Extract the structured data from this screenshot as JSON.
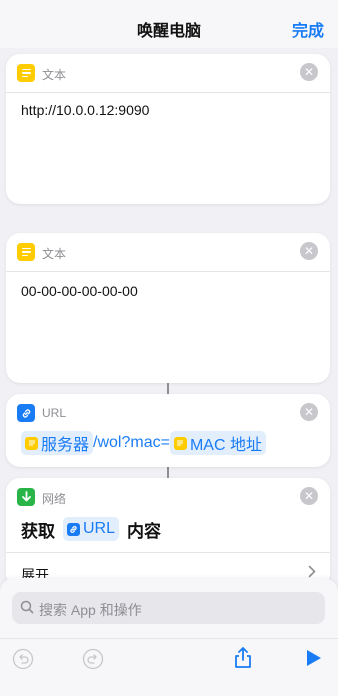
{
  "nav": {
    "title": "唤醒电脑",
    "done_label": "完成"
  },
  "actions": [
    {
      "label": "文本",
      "value": "http://10.0.0.12:9090",
      "icon": "text-icon",
      "color": "#ffcc00"
    },
    {
      "label": "文本",
      "value": "00-00-00-00-00-00",
      "icon": "text-icon",
      "color": "#ffcc00"
    },
    {
      "label": "URL",
      "icon": "link-icon",
      "color": "#1a7cf5",
      "token_server": "服务器",
      "path_text": "/wol?mac=",
      "token_mac": "MAC 地址"
    },
    {
      "label": "网络",
      "icon": "download-icon",
      "color": "#28b446",
      "get_label": "获取",
      "token_url": "URL",
      "content_label": "内容",
      "expand_label": "展开"
    }
  ],
  "search": {
    "placeholder": "搜索 App 和操作"
  },
  "toolbar": {
    "icons": [
      "undo-icon",
      "redo-icon",
      "share-icon",
      "play-icon"
    ]
  },
  "colors": {
    "accent": "#1a7cf5",
    "background": "#f0f0f5"
  }
}
